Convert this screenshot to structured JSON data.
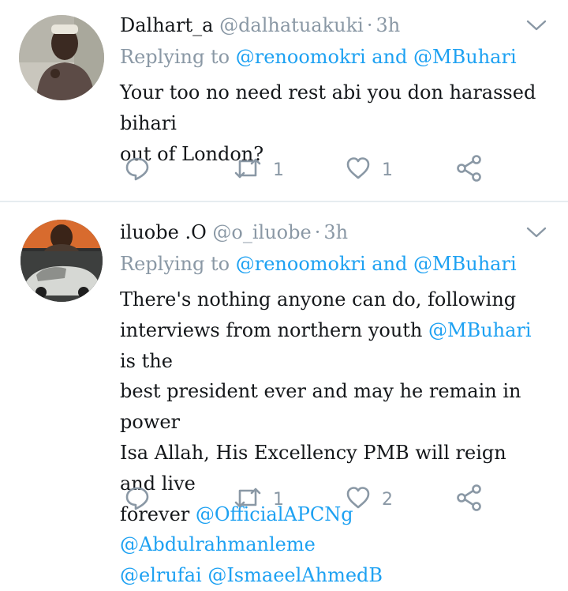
{
  "tweets": [
    {
      "name": "Dalhart_a",
      "handle": "@dalhatuakuki",
      "time": "3h",
      "replying_prefix": "Replying to",
      "replying_to": "@renoomokri and @MBuhari",
      "text_lines": [
        "Your too no need rest abi you don harassed bihari",
        "out of London?"
      ],
      "retweets": "1",
      "likes": "1"
    },
    {
      "name": "iluobe .O",
      "handle": "@o_iluobe",
      "time": "3h",
      "replying_prefix": "Replying to",
      "replying_to": "@renoomokri and @MBuhari",
      "text_parts": {
        "l1": "There's nothing anyone can do, following",
        "l2a": "interviews from northern youth ",
        "l2m": "@MBuhari",
        "l2b": " is the",
        "l3": "best president ever and may he remain in power",
        "l4": "Isa Allah, His Excellency PMB will reign and live",
        "l5a": "forever ",
        "l5m1": "@OfficialAPCNg",
        "l5m2": "@Abdulrahmanleme",
        "l6m1": "@elrufai",
        "l6m2": "@IsmaeelAhmedB"
      },
      "retweets": "1",
      "likes": "2"
    }
  ],
  "colors": {
    "text": "#14171a",
    "muted": "#8a98a5",
    "link": "#1da1f2",
    "divider": "#e6ecf0"
  },
  "icons": [
    "reply-icon",
    "retweet-icon",
    "like-icon",
    "share-icon",
    "chevron-down-icon"
  ]
}
